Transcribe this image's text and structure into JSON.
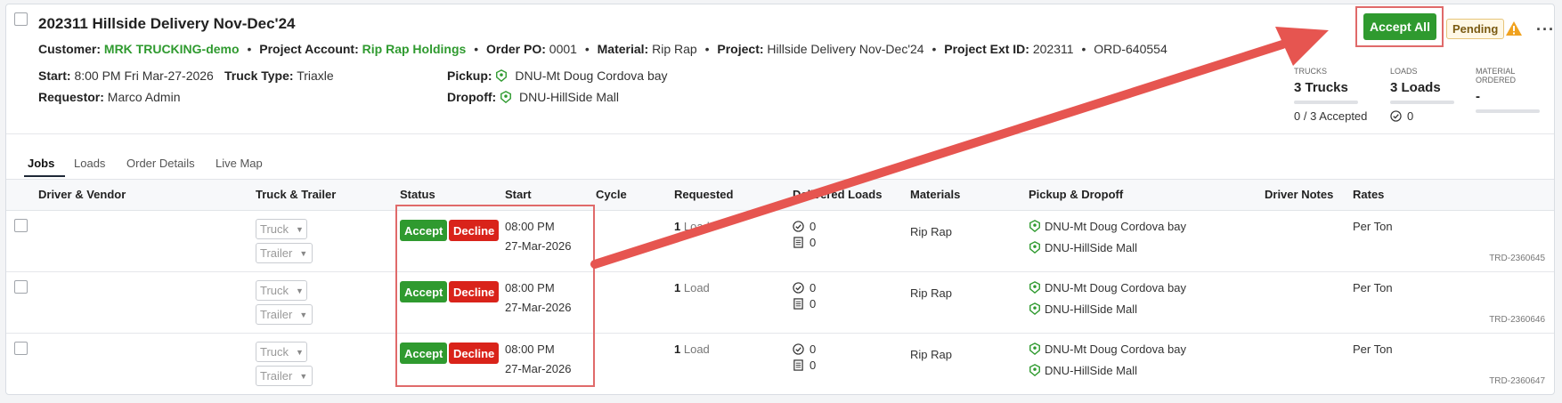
{
  "order": {
    "title": "202311 Hillside Delivery Nov-Dec'24",
    "customer_label": "Customer:",
    "customer": "MRK TRUCKING-demo",
    "project_account_label": "Project Account:",
    "project_account": "Rip Rap Holdings",
    "order_po_label": "Order PO:",
    "order_po": "0001",
    "material_label": "Material:",
    "material": "Rip Rap",
    "project_label": "Project:",
    "project": "Hillside Delivery Nov-Dec'24",
    "project_ext_label": "Project Ext ID:",
    "project_ext": "202311",
    "order_id": "ORD-640554",
    "start_label": "Start:",
    "start": "8:00 PM Fri Mar-27-2026",
    "truck_type_label": "Truck Type:",
    "truck_type": "Triaxle",
    "requestor_label": "Requestor:",
    "requestor": "Marco Admin",
    "pickup_label": "Pickup:",
    "pickup": "DNU-Mt Doug Cordova bay",
    "dropoff_label": "Dropoff:",
    "dropoff": "DNU-HillSide Mall"
  },
  "actions": {
    "accept_all": "Accept All",
    "status_badge": "Pending",
    "more": "···"
  },
  "stats": {
    "trucks_label": "TRUCKS",
    "trucks_value": "3 Trucks",
    "trucks_sub": "0 / 3 Accepted",
    "loads_label": "LOADS",
    "loads_value": "3 Loads",
    "loads_sub": "0",
    "material_label": "MATERIAL ORDERED",
    "material_value": "-"
  },
  "tabs": [
    "Jobs",
    "Loads",
    "Order Details",
    "Live Map"
  ],
  "columns": [
    "Driver & Vendor",
    "Truck & Trailer",
    "Status",
    "Start",
    "Cycle",
    "Requested",
    "Delivered Loads",
    "Materials",
    "Pickup & Dropoff",
    "Driver Notes",
    "Rates"
  ],
  "rows": [
    {
      "truck": "Truck",
      "trailer": "Trailer",
      "accept": "Accept",
      "decline": "Decline",
      "time": "08:00 PM",
      "date": "27-Mar-2026",
      "req_n": "1",
      "req_unit": "Load",
      "delivered": "0",
      "tickets": "0",
      "material": "Rip Rap",
      "pickup": "DNU-Mt Doug Cordova bay",
      "dropoff": "DNU-HillSide Mall",
      "rate": "Per Ton",
      "trd": "TRD-2360645"
    },
    {
      "truck": "Truck",
      "trailer": "Trailer",
      "accept": "Accept",
      "decline": "Decline",
      "time": "08:00 PM",
      "date": "27-Mar-2026",
      "req_n": "1",
      "req_unit": "Load",
      "delivered": "0",
      "tickets": "0",
      "material": "Rip Rap",
      "pickup": "DNU-Mt Doug Cordova bay",
      "dropoff": "DNU-HillSide Mall",
      "rate": "Per Ton",
      "trd": "TRD-2360646"
    },
    {
      "truck": "Truck",
      "trailer": "Trailer",
      "accept": "Accept",
      "decline": "Decline",
      "time": "08:00 PM",
      "date": "27-Mar-2026",
      "req_n": "1",
      "req_unit": "Load",
      "delivered": "0",
      "tickets": "0",
      "material": "Rip Rap",
      "pickup": "DNU-Mt Doug Cordova bay",
      "dropoff": "DNU-HillSide Mall",
      "rate": "Per Ton",
      "trd": "TRD-2360647"
    }
  ],
  "colors": {
    "accent_green": "#2f9a2f",
    "decline_red": "#d9231a",
    "annotation_red": "#e65550"
  },
  "icons": {
    "location": "location-pin-icon",
    "warning": "warning-triangle-icon",
    "check": "check-circle-icon",
    "ticket": "ticket-list-icon"
  }
}
